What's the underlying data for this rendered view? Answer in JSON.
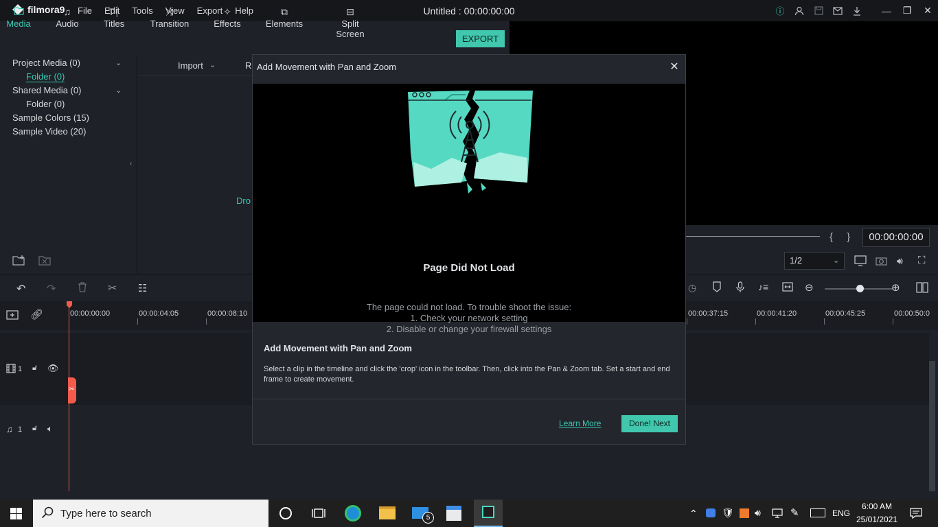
{
  "app": {
    "name": "filmora9",
    "window_title": "Untitled : 00:00:00:00",
    "menu": [
      "File",
      "Edit",
      "Tools",
      "View",
      "Export",
      "Help"
    ]
  },
  "media_tabs": [
    {
      "label": "Media",
      "icon": "folder-icon"
    },
    {
      "label": "Audio",
      "icon": "music-note-icon"
    },
    {
      "label": "Titles",
      "icon": "text-icon"
    },
    {
      "label": "Transition",
      "icon": "transition-icon"
    },
    {
      "label": "Effects",
      "icon": "effects-icon"
    },
    {
      "label": "Elements",
      "icon": "elements-icon"
    },
    {
      "label": "Split Screen",
      "icon": "split-screen-icon"
    }
  ],
  "export_label": "EXPORT",
  "library": {
    "items": [
      {
        "label": "Project Media (0)",
        "indent": 0,
        "expand": true,
        "selected": false
      },
      {
        "label": "Folder (0)",
        "indent": 1,
        "expand": false,
        "selected": true
      },
      {
        "label": "Shared Media (0)",
        "indent": 0,
        "expand": true,
        "selected": false
      },
      {
        "label": "Folder (0)",
        "indent": 1,
        "expand": false,
        "selected": false
      },
      {
        "label": "Sample Colors (15)",
        "indent": 0,
        "expand": false,
        "selected": false
      },
      {
        "label": "Sample Video (20)",
        "indent": 0,
        "expand": false,
        "selected": false
      }
    ]
  },
  "media_area": {
    "import_label": "Import",
    "record_label": "R",
    "drop_text": "Dro"
  },
  "preview": {
    "timecode": "00:00:00:00",
    "ratio": "1/2",
    "braces": "{ }"
  },
  "timeline": {
    "ticks": [
      "00:00:00:00",
      "00:00:04:05",
      "00:00:08:10",
      "00:00:37:15",
      "00:00:41:20",
      "00:00:45:25",
      "00:00:50:0"
    ],
    "video_track": "1",
    "audio_track": "1"
  },
  "dialog": {
    "title": "Add Movement with Pan and Zoom",
    "error_title": "Page Did Not Load",
    "error_lines": [
      "The page could not load. To trouble shoot the issue:",
      "1. Check your network setting",
      "2. Disable or change your firewall settings"
    ],
    "info_title": "Add Movement with Pan and Zoom",
    "info_desc": "Select a clip in the timeline and click the 'crop' icon in the toolbar. Then, click into the Pan & Zoom tab. Set a start and end frame to create movement.",
    "learn_more": "Learn More",
    "done_label": "Done! Next"
  },
  "taskbar": {
    "search_placeholder": "Type here to search",
    "mail_badge": "5",
    "language": "ENG",
    "time": "6:00 AM",
    "date": "25/01/2021"
  },
  "colors": {
    "accent": "#40c7ae",
    "playhead": "#f25b4c",
    "background": "#1e2127"
  }
}
